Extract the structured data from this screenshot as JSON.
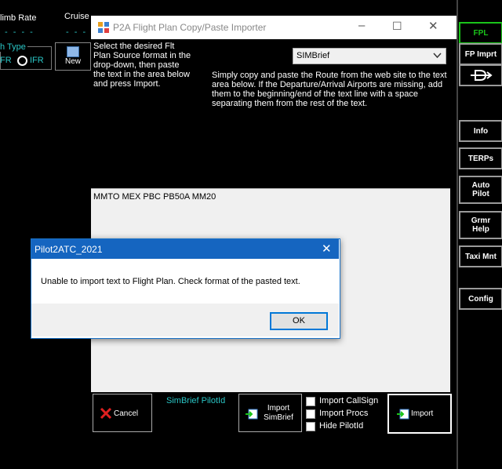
{
  "background": {
    "climb_rate_label": "limb Rate",
    "cruise_label": "Cruise",
    "dashes_left": "- - - -",
    "dashes_cruise": "- - - -",
    "flight_type_label": "h Type",
    "vfr_label": "FR",
    "ifr_label": "IFR",
    "new_label": "New"
  },
  "right_panel": {
    "fpl": "FPL",
    "fp_imprt": "FP Imprt",
    "info": "Info",
    "terps": "TERPs",
    "auto_pilot_line1": "Auto",
    "auto_pilot_line2": "Pilot",
    "grmr_help_line1": "Grmr",
    "grmr_help_line2": "Help",
    "taxi_mnt": "Taxi Mnt",
    "config": "Config",
    "fpl_color": "#1ac41a"
  },
  "importer": {
    "title": "P2A Flight Plan Copy/Paste Importer",
    "instructions_lines": [
      "Select the desired Flt",
      "Plan Source format in the",
      "drop-down, then paste",
      "the text in the area below",
      "and press Import."
    ],
    "source_selected": "SIMBrief",
    "help_lines": [
      "Simply copy and paste the Route from the web site to the text",
      "area below. If the Departure/Arrival Airports are missing, add",
      "them to the beginning/end of the text line with a space",
      "separating them from the rest of the text."
    ],
    "pasted_text": "MMTO MEX PBC PB50A MM20",
    "cancel_label": "Cancel",
    "simbrief_pilotid_label": "SimBrief PilotId",
    "import_simbrief_line1": "Import",
    "import_simbrief_line2": "SimBrief",
    "import_callsign_label": "Import CallSign",
    "import_procs_label": "Import Procs",
    "hide_pilotid_label": "Hide PilotId",
    "import_label": "Import"
  },
  "dialog": {
    "title": "Pilot2ATC_2021",
    "message": "Unable to import text to Flight Plan.  Check format of the pasted text.",
    "ok_label": "OK",
    "title_color": "#1565c0"
  }
}
